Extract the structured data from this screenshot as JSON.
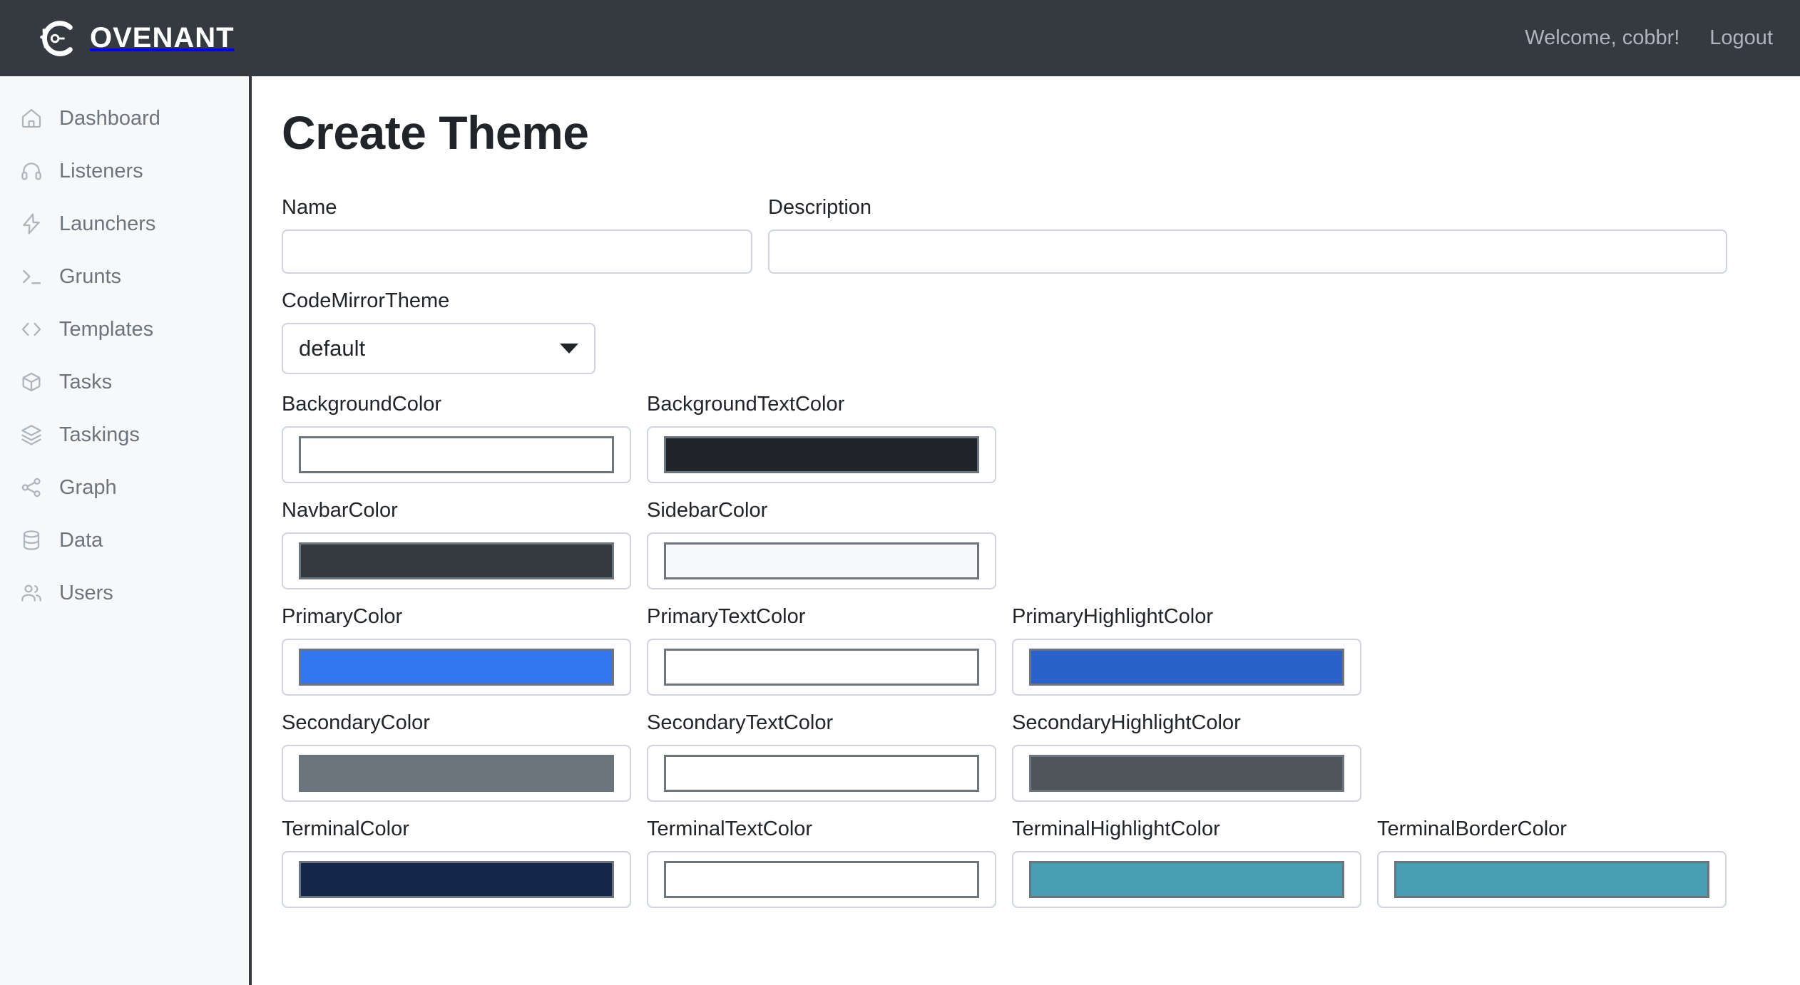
{
  "navbar": {
    "brand_text": "OVENANT",
    "welcome": "Welcome, cobbr!",
    "logout": "Logout"
  },
  "sidebar": {
    "items": [
      {
        "label": "Dashboard",
        "icon": "home-icon"
      },
      {
        "label": "Listeners",
        "icon": "headphones-icon"
      },
      {
        "label": "Launchers",
        "icon": "lightning-bolt-icon"
      },
      {
        "label": "Grunts",
        "icon": "terminal-prompt-icon"
      },
      {
        "label": "Templates",
        "icon": "code-brackets-icon"
      },
      {
        "label": "Tasks",
        "icon": "box-icon"
      },
      {
        "label": "Taskings",
        "icon": "layers-icon"
      },
      {
        "label": "Graph",
        "icon": "share-nodes-icon"
      },
      {
        "label": "Data",
        "icon": "database-icon"
      },
      {
        "label": "Users",
        "icon": "users-icon"
      }
    ]
  },
  "main": {
    "page_title": "Create Theme",
    "name": {
      "label": "Name",
      "value": "",
      "placeholder": ""
    },
    "description": {
      "label": "Description",
      "value": "",
      "placeholder": ""
    },
    "codemirror_theme": {
      "label": "CodeMirrorTheme",
      "selected": "default",
      "options": [
        "default"
      ]
    },
    "colors": [
      [
        {
          "label": "BackgroundColor",
          "value": "#ffffff"
        },
        {
          "label": "BackgroundTextColor",
          "value": "#212529"
        }
      ],
      [
        {
          "label": "NavbarColor",
          "value": "#343a40"
        },
        {
          "label": "SidebarColor",
          "value": "#f7f8f9"
        }
      ],
      [
        {
          "label": "PrimaryColor",
          "value": "#3376ee"
        },
        {
          "label": "PrimaryTextColor",
          "value": "#ffffff"
        },
        {
          "label": "PrimaryHighlightColor",
          "value": "#2a62c9"
        }
      ],
      [
        {
          "label": "SecondaryColor",
          "value": "#6c757d"
        },
        {
          "label": "SecondaryTextColor",
          "value": "#ffffff"
        },
        {
          "label": "SecondaryHighlightColor",
          "value": "#4e555b"
        }
      ],
      [
        {
          "label": "TerminalColor",
          "value": "#14274a"
        },
        {
          "label": "TerminalTextColor",
          "value": "#ffffff"
        },
        {
          "label": "TerminalHighlightColor",
          "value": "#469fb2"
        },
        {
          "label": "TerminalBorderColor",
          "value": "#469fb2"
        }
      ]
    ]
  }
}
